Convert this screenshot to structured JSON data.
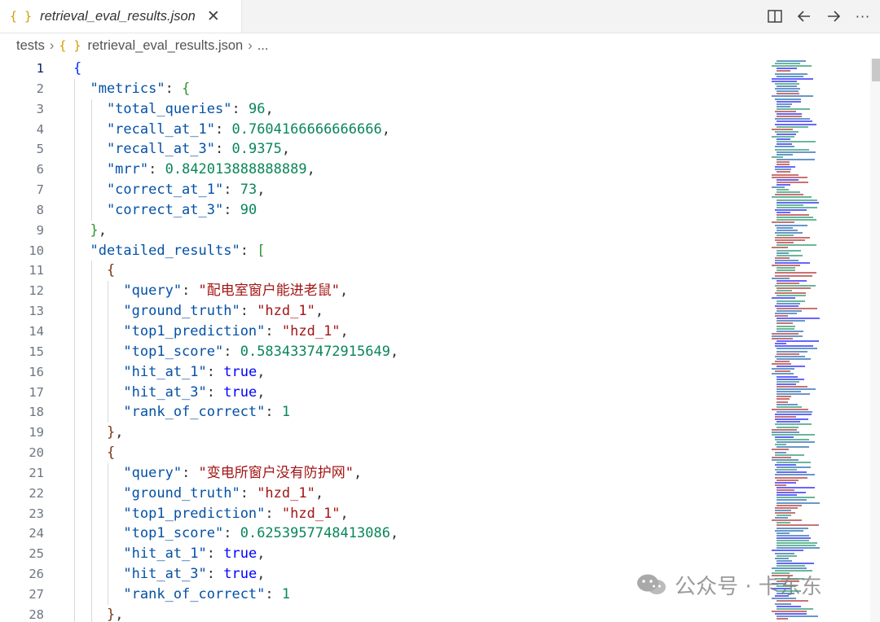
{
  "tab": {
    "icon": "json-braces-icon",
    "label": "retrieval_eval_results.json",
    "close_glyph": "✕"
  },
  "toolbar": {
    "icons": [
      "split-editor-icon",
      "back-arrow-icon",
      "forward-arrow-icon",
      "more-icon"
    ],
    "more_label": "···"
  },
  "breadcrumb": {
    "folder": "tests",
    "file": "retrieval_eval_results.json",
    "tail": "...",
    "json_icon": "{ }"
  },
  "editor": {
    "active_line": 1,
    "lines": [
      [
        {
          "t": "{",
          "c": "br1"
        }
      ],
      [
        {
          "t": "  \"metrics\"",
          "c": "k"
        },
        {
          "t": ": ",
          "c": "p"
        },
        {
          "t": "{",
          "c": "br2"
        }
      ],
      [
        {
          "t": "    \"total_queries\"",
          "c": "k"
        },
        {
          "t": ": ",
          "c": "p"
        },
        {
          "t": "96",
          "c": "n"
        },
        {
          "t": ",",
          "c": "p"
        }
      ],
      [
        {
          "t": "    \"recall_at_1\"",
          "c": "k"
        },
        {
          "t": ": ",
          "c": "p"
        },
        {
          "t": "0.7604166666666666",
          "c": "n"
        },
        {
          "t": ",",
          "c": "p"
        }
      ],
      [
        {
          "t": "    \"recall_at_3\"",
          "c": "k"
        },
        {
          "t": ": ",
          "c": "p"
        },
        {
          "t": "0.9375",
          "c": "n"
        },
        {
          "t": ",",
          "c": "p"
        }
      ],
      [
        {
          "t": "    \"mrr\"",
          "c": "k"
        },
        {
          "t": ": ",
          "c": "p"
        },
        {
          "t": "0.842013888888889",
          "c": "n"
        },
        {
          "t": ",",
          "c": "p"
        }
      ],
      [
        {
          "t": "    \"correct_at_1\"",
          "c": "k"
        },
        {
          "t": ": ",
          "c": "p"
        },
        {
          "t": "73",
          "c": "n"
        },
        {
          "t": ",",
          "c": "p"
        }
      ],
      [
        {
          "t": "    \"correct_at_3\"",
          "c": "k"
        },
        {
          "t": ": ",
          "c": "p"
        },
        {
          "t": "90",
          "c": "n"
        }
      ],
      [
        {
          "t": "  ",
          "c": "p"
        },
        {
          "t": "}",
          "c": "br2"
        },
        {
          "t": ",",
          "c": "p"
        }
      ],
      [
        {
          "t": "  \"detailed_results\"",
          "c": "k"
        },
        {
          "t": ": ",
          "c": "p"
        },
        {
          "t": "[",
          "c": "br2"
        }
      ],
      [
        {
          "t": "    ",
          "c": "p"
        },
        {
          "t": "{",
          "c": "br3"
        }
      ],
      [
        {
          "t": "      \"query\"",
          "c": "k"
        },
        {
          "t": ": ",
          "c": "p"
        },
        {
          "t": "\"配电室窗户能进老鼠\"",
          "c": "s"
        },
        {
          "t": ",",
          "c": "p"
        }
      ],
      [
        {
          "t": "      \"ground_truth\"",
          "c": "k"
        },
        {
          "t": ": ",
          "c": "p"
        },
        {
          "t": "\"hzd_1\"",
          "c": "s"
        },
        {
          "t": ",",
          "c": "p"
        }
      ],
      [
        {
          "t": "      \"top1_prediction\"",
          "c": "k"
        },
        {
          "t": ": ",
          "c": "p"
        },
        {
          "t": "\"hzd_1\"",
          "c": "s"
        },
        {
          "t": ",",
          "c": "p"
        }
      ],
      [
        {
          "t": "      \"top1_score\"",
          "c": "k"
        },
        {
          "t": ": ",
          "c": "p"
        },
        {
          "t": "0.5834337472915649",
          "c": "n"
        },
        {
          "t": ",",
          "c": "p"
        }
      ],
      [
        {
          "t": "      \"hit_at_1\"",
          "c": "k"
        },
        {
          "t": ": ",
          "c": "p"
        },
        {
          "t": "true",
          "c": "b"
        },
        {
          "t": ",",
          "c": "p"
        }
      ],
      [
        {
          "t": "      \"hit_at_3\"",
          "c": "k"
        },
        {
          "t": ": ",
          "c": "p"
        },
        {
          "t": "true",
          "c": "b"
        },
        {
          "t": ",",
          "c": "p"
        }
      ],
      [
        {
          "t": "      \"rank_of_correct\"",
          "c": "k"
        },
        {
          "t": ": ",
          "c": "p"
        },
        {
          "t": "1",
          "c": "n"
        }
      ],
      [
        {
          "t": "    ",
          "c": "p"
        },
        {
          "t": "}",
          "c": "br3"
        },
        {
          "t": ",",
          "c": "p"
        }
      ],
      [
        {
          "t": "    ",
          "c": "p"
        },
        {
          "t": "{",
          "c": "br3"
        }
      ],
      [
        {
          "t": "      \"query\"",
          "c": "k"
        },
        {
          "t": ": ",
          "c": "p"
        },
        {
          "t": "\"变电所窗户没有防护网\"",
          "c": "s"
        },
        {
          "t": ",",
          "c": "p"
        }
      ],
      [
        {
          "t": "      \"ground_truth\"",
          "c": "k"
        },
        {
          "t": ": ",
          "c": "p"
        },
        {
          "t": "\"hzd_1\"",
          "c": "s"
        },
        {
          "t": ",",
          "c": "p"
        }
      ],
      [
        {
          "t": "      \"top1_prediction\"",
          "c": "k"
        },
        {
          "t": ": ",
          "c": "p"
        },
        {
          "t": "\"hzd_1\"",
          "c": "s"
        },
        {
          "t": ",",
          "c": "p"
        }
      ],
      [
        {
          "t": "      \"top1_score\"",
          "c": "k"
        },
        {
          "t": ": ",
          "c": "p"
        },
        {
          "t": "0.6253957748413086",
          "c": "n"
        },
        {
          "t": ",",
          "c": "p"
        }
      ],
      [
        {
          "t": "      \"hit_at_1\"",
          "c": "k"
        },
        {
          "t": ": ",
          "c": "p"
        },
        {
          "t": "true",
          "c": "b"
        },
        {
          "t": ",",
          "c": "p"
        }
      ],
      [
        {
          "t": "      \"hit_at_3\"",
          "c": "k"
        },
        {
          "t": ": ",
          "c": "p"
        },
        {
          "t": "true",
          "c": "b"
        },
        {
          "t": ",",
          "c": "p"
        }
      ],
      [
        {
          "t": "      \"rank_of_correct\"",
          "c": "k"
        },
        {
          "t": ": ",
          "c": "p"
        },
        {
          "t": "1",
          "c": "n"
        }
      ],
      [
        {
          "t": "    ",
          "c": "p"
        },
        {
          "t": "}",
          "c": "br3"
        },
        {
          "t": ",",
          "c": "p"
        }
      ]
    ]
  },
  "watermark": {
    "icon": "wechat-icon",
    "text": "公众号 · 卡东东"
  },
  "colors": {
    "key": "#0451a5",
    "string": "#a31515",
    "number": "#098658",
    "boolean": "#0000ff",
    "json_icon": "#d39c00"
  }
}
